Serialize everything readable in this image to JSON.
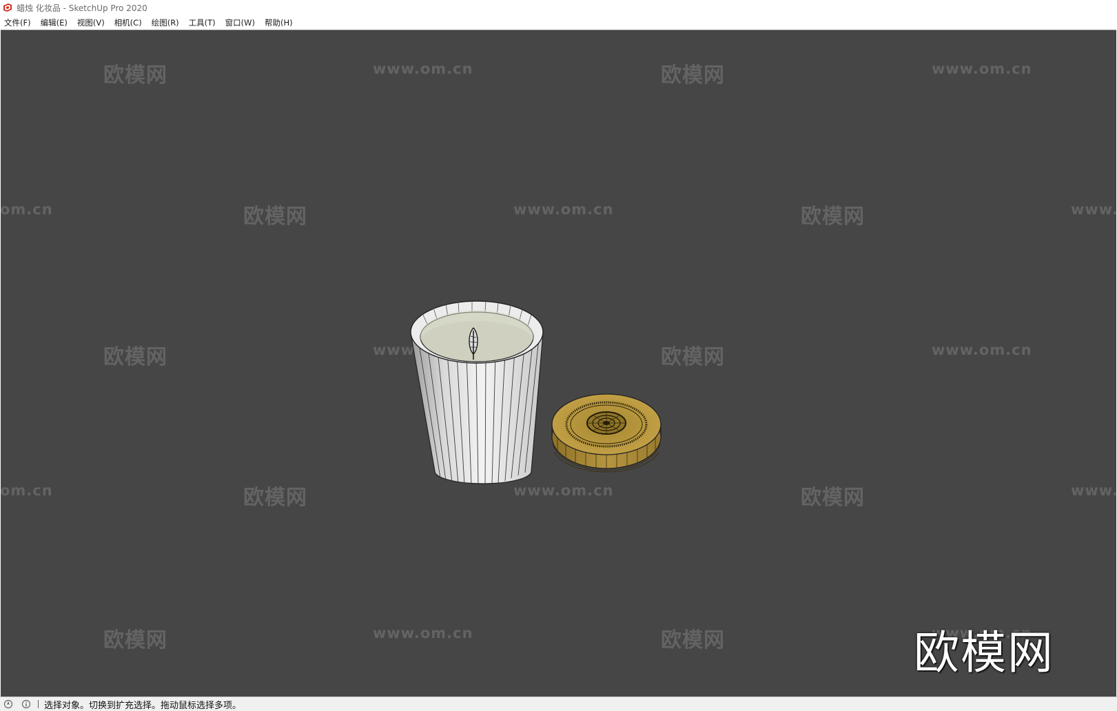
{
  "window": {
    "title": "蜡烛 化妆品 - SketchUp Pro 2020"
  },
  "menu": [
    {
      "label": "文件(F)"
    },
    {
      "label": "编辑(E)"
    },
    {
      "label": "视图(V)"
    },
    {
      "label": "相机(C)"
    },
    {
      "label": "绘图(R)"
    },
    {
      "label": "工具(T)"
    },
    {
      "label": "窗口(W)"
    },
    {
      "label": "帮助(H)"
    }
  ],
  "viewport": {
    "watermark_logo": "欧模网",
    "watermark_url": "www.om.cn",
    "watermark_url_cut_left": "om.cn",
    "watermark_url_cut_right": "www.",
    "big_logo": "欧模网",
    "background_color": "#464646",
    "model": [
      "candle-jar",
      "wooden-lid"
    ]
  },
  "status": {
    "text": "选择对象。切换到扩充选择。拖动鼠标选择多项。",
    "icons": [
      "geolocation-icon",
      "info-icon"
    ]
  },
  "colors": {
    "sketchup_red": "#d52b1e",
    "lid_gold": "#b6953f",
    "wax": "#cfd0bf"
  }
}
